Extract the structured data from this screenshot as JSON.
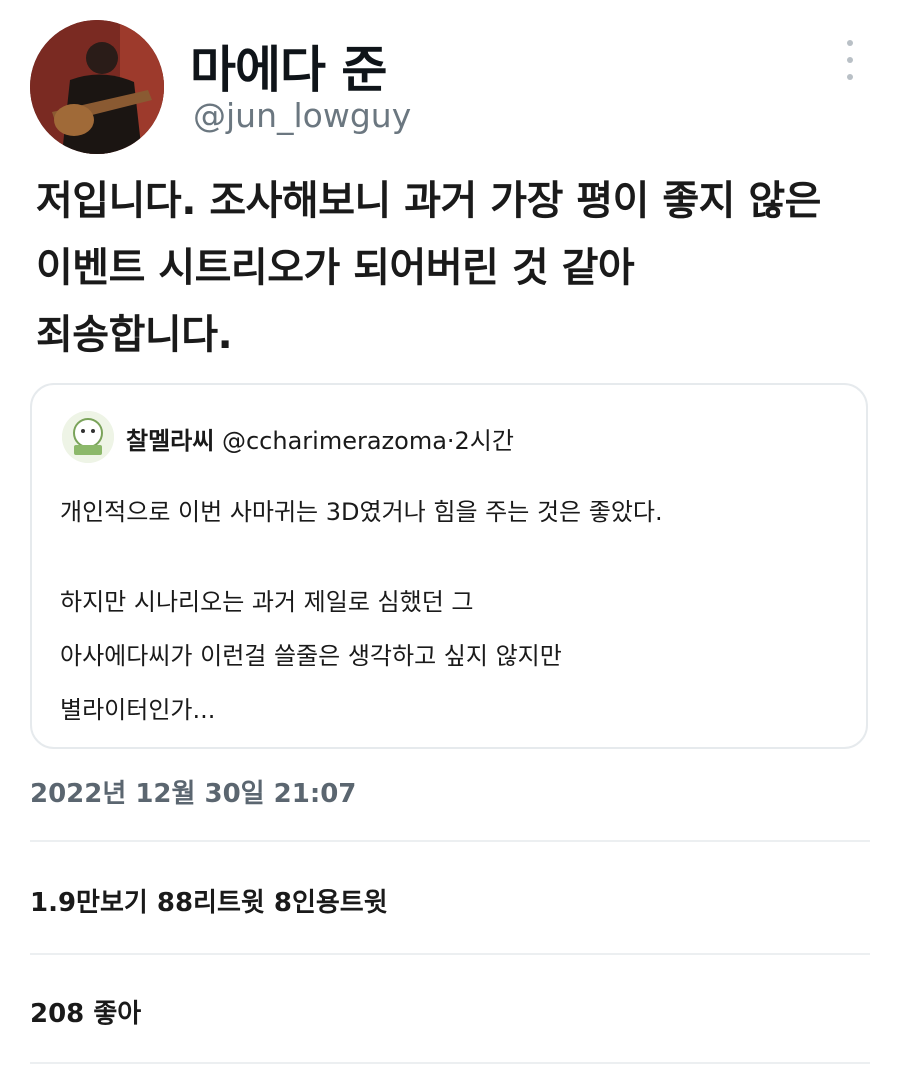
{
  "author": {
    "display_name": "마에다 준",
    "handle": "@jun_lowguy"
  },
  "tweet": {
    "lines": [
      "저입니다. 조사해보니 과거 가장 평이 좋지 않은",
      "이벤트 시트리오가 되어버린 것 같아",
      "죄송합니다."
    ]
  },
  "quoted": {
    "name": "찰멜라씨",
    "handle_time": "@ccharimerazoma·2시간",
    "paragraph1": "개인적으로 이번 사마귀는 3D였거나 힘을 주는 것은 좋았다.",
    "paragraph2": [
      "하지만 시나리오는 과거 제일로 심했던 그",
      "아사에다씨가 이런걸 쓸줄은 생각하고 싶지 않지만",
      "별라이터인가..."
    ]
  },
  "timestamp": "2022년 12월 30일 21:07",
  "stats": "1.9만보기 88리트윗 8인용트윗",
  "likes": "208 좋아",
  "icons": {
    "more": "more-vertical-icon"
  }
}
